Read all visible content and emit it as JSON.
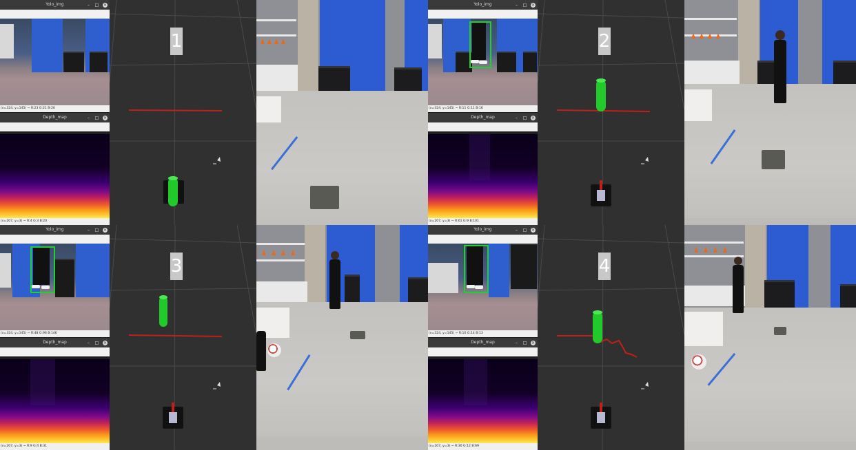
{
  "panels": [
    {
      "number": "1",
      "yolo_title": "Yolo_img",
      "yolo_status": "(x=324, y=145) ~ R:23 G:21 B:26",
      "depth_title": "Depth_map",
      "depth_status": "(x=207, y=3) ~ R:4 G:3 B:20",
      "person_detected": false
    },
    {
      "number": "2",
      "yolo_title": "Yolo_img",
      "yolo_status": "(x=324, y=145) ~ R:11 G:11 B:16",
      "depth_title": "Depth_map",
      "depth_status": "(x=207, y=3) ~ R:61 G:9 B:101",
      "person_detected": true
    },
    {
      "number": "3",
      "yolo_title": "Yolo_img",
      "yolo_status": "(x=324, y=145) ~ R:48 G:96 B:146",
      "depth_title": "Depth_map",
      "depth_status": "(x=207, y=3) ~ R:9 G:4 B:31",
      "person_detected": true
    },
    {
      "number": "4",
      "yolo_title": "Yolo_img",
      "yolo_status": "(x=324, y=145) ~ R:10 G:14 B:13",
      "depth_title": "Depth_map",
      "depth_status": "(x=207, y=3) ~ R:30 G:12 B:69",
      "person_detected": true
    }
  ],
  "window_buttons": {
    "minimize": "–",
    "maximize": "□",
    "close": "×"
  },
  "colors": {
    "rviz_bg": "#303030",
    "path_red": "#c0201a",
    "cylinder_green": "#22c92a",
    "bbox_green": "#20d030",
    "wall_blue": "#2d5bd2"
  },
  "icons": [
    "close-icon",
    "maximize-icon",
    "minimize-icon",
    "cursor-icon",
    "robot-marker-icon"
  ]
}
